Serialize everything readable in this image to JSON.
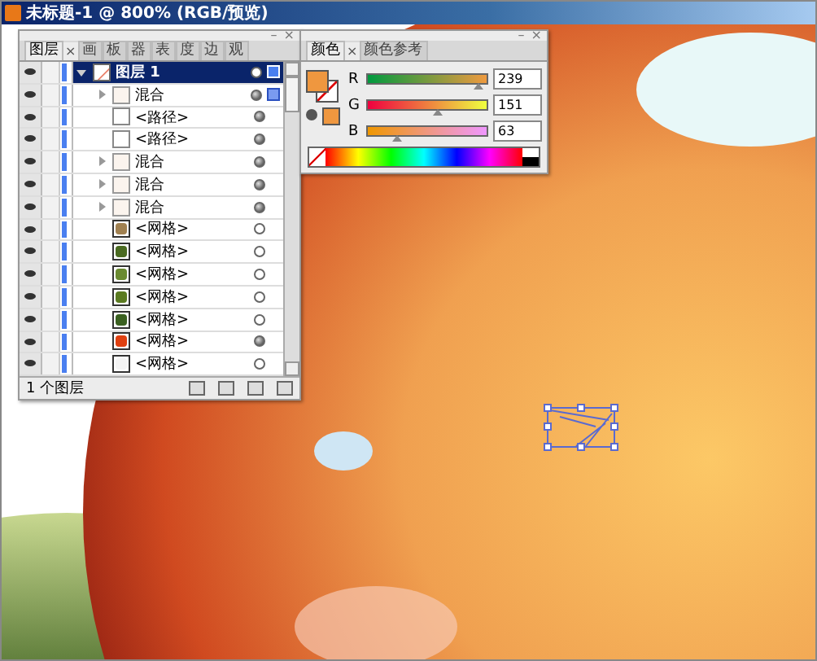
{
  "window": {
    "title": "未标题-1 @ 800% (RGB/预览)"
  },
  "layers_panel": {
    "panel_buttons": [
      "–",
      "×"
    ],
    "tabs": [
      {
        "label": "图层",
        "selected": true,
        "close_label": "×"
      },
      {
        "label": "画",
        "selected": false
      },
      {
        "label": "板",
        "selected": false
      },
      {
        "label": "器",
        "selected": false
      },
      {
        "label": "表",
        "selected": false
      },
      {
        "label": "度",
        "selected": false
      },
      {
        "label": "边",
        "selected": false
      },
      {
        "label": "观",
        "selected": false
      }
    ],
    "rows": [
      {
        "name": "图层 1",
        "kind": "layer",
        "selected": true,
        "expanded": true,
        "appearance": false,
        "marked": true,
        "children": [
          {
            "name": "混合",
            "kind": "group",
            "selected": false,
            "expanded": false,
            "appearance": true,
            "marked": true
          },
          {
            "name": "<路径>",
            "kind": "path",
            "selected": false,
            "appearance": true,
            "marked": false
          },
          {
            "name": "<路径>",
            "kind": "path",
            "selected": false,
            "appearance": true,
            "marked": false
          },
          {
            "name": "混合",
            "kind": "group",
            "selected": false,
            "expanded": false,
            "appearance": true,
            "marked": false
          },
          {
            "name": "混合",
            "kind": "group",
            "selected": false,
            "expanded": false,
            "appearance": true,
            "marked": false
          },
          {
            "name": "混合",
            "kind": "group",
            "selected": false,
            "expanded": false,
            "appearance": true,
            "marked": false
          },
          {
            "name": "<网格>",
            "kind": "mesh",
            "selected": false,
            "appearance": false,
            "marked": false,
            "color": "#a08050"
          },
          {
            "name": "<网格>",
            "kind": "mesh",
            "selected": false,
            "appearance": false,
            "marked": false,
            "color": "#4a6a20"
          },
          {
            "name": "<网格>",
            "kind": "mesh",
            "selected": false,
            "appearance": false,
            "marked": false,
            "color": "#6a8a30"
          },
          {
            "name": "<网格>",
            "kind": "mesh",
            "selected": false,
            "appearance": false,
            "marked": false,
            "color": "#5a7a20"
          },
          {
            "name": "<网格>",
            "kind": "mesh",
            "selected": false,
            "appearance": false,
            "marked": false,
            "color": "#3a6020"
          },
          {
            "name": "<网格>",
            "kind": "mesh",
            "selected": false,
            "appearance": true,
            "marked": false,
            "color": "#e04010"
          },
          {
            "name": "<网格>",
            "kind": "mesh",
            "selected": false,
            "appearance": false,
            "marked": false,
            "color": "#f4f4f4"
          }
        ]
      }
    ],
    "status": "1 个图层"
  },
  "color_panel": {
    "panel_buttons": [
      "–",
      "×"
    ],
    "tabs": [
      {
        "label": "颜色",
        "selected": true,
        "close_label": "×"
      },
      {
        "label": "颜色参考",
        "selected": false
      }
    ],
    "fill_swatch": {
      "color": "#ef973f"
    },
    "channels": [
      {
        "name": "R",
        "level": 0.937,
        "value": "239",
        "kind": "red"
      },
      {
        "name": "G",
        "level": 0.592,
        "value": "151",
        "kind": "green"
      },
      {
        "name": "B",
        "level": 0.247,
        "value": "63",
        "kind": "blue"
      }
    ]
  }
}
